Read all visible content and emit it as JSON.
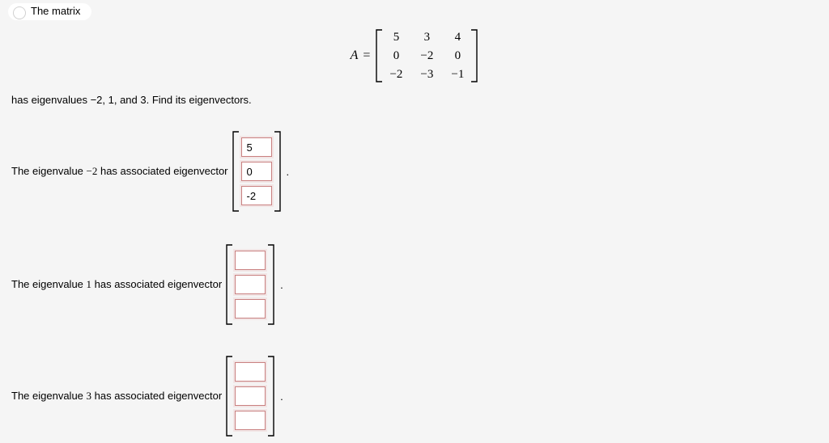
{
  "intro": "The matrix",
  "matrix": {
    "label_A": "A",
    "equals": "=",
    "rows": [
      [
        "5",
        "3",
        "4"
      ],
      [
        "0",
        "−2",
        "0"
      ],
      [
        "−2",
        "−3",
        "−1"
      ]
    ]
  },
  "instructions": "has eigenvalues −2, 1, and 3. Find its eigenvectors.",
  "vectors": [
    {
      "label_pre": "The eigenvalue ",
      "eigenvalue": "−2",
      "label_post": " has associated eigenvector",
      "values": [
        "5",
        "0",
        "-2"
      ]
    },
    {
      "label_pre": "The eigenvalue ",
      "eigenvalue": "1",
      "label_post": " has associated eigenvector",
      "values": [
        "",
        "",
        ""
      ]
    },
    {
      "label_pre": "The eigenvalue ",
      "eigenvalue": "3",
      "label_post": " has associated eigenvector",
      "values": [
        "",
        "",
        ""
      ]
    }
  ],
  "period": "."
}
